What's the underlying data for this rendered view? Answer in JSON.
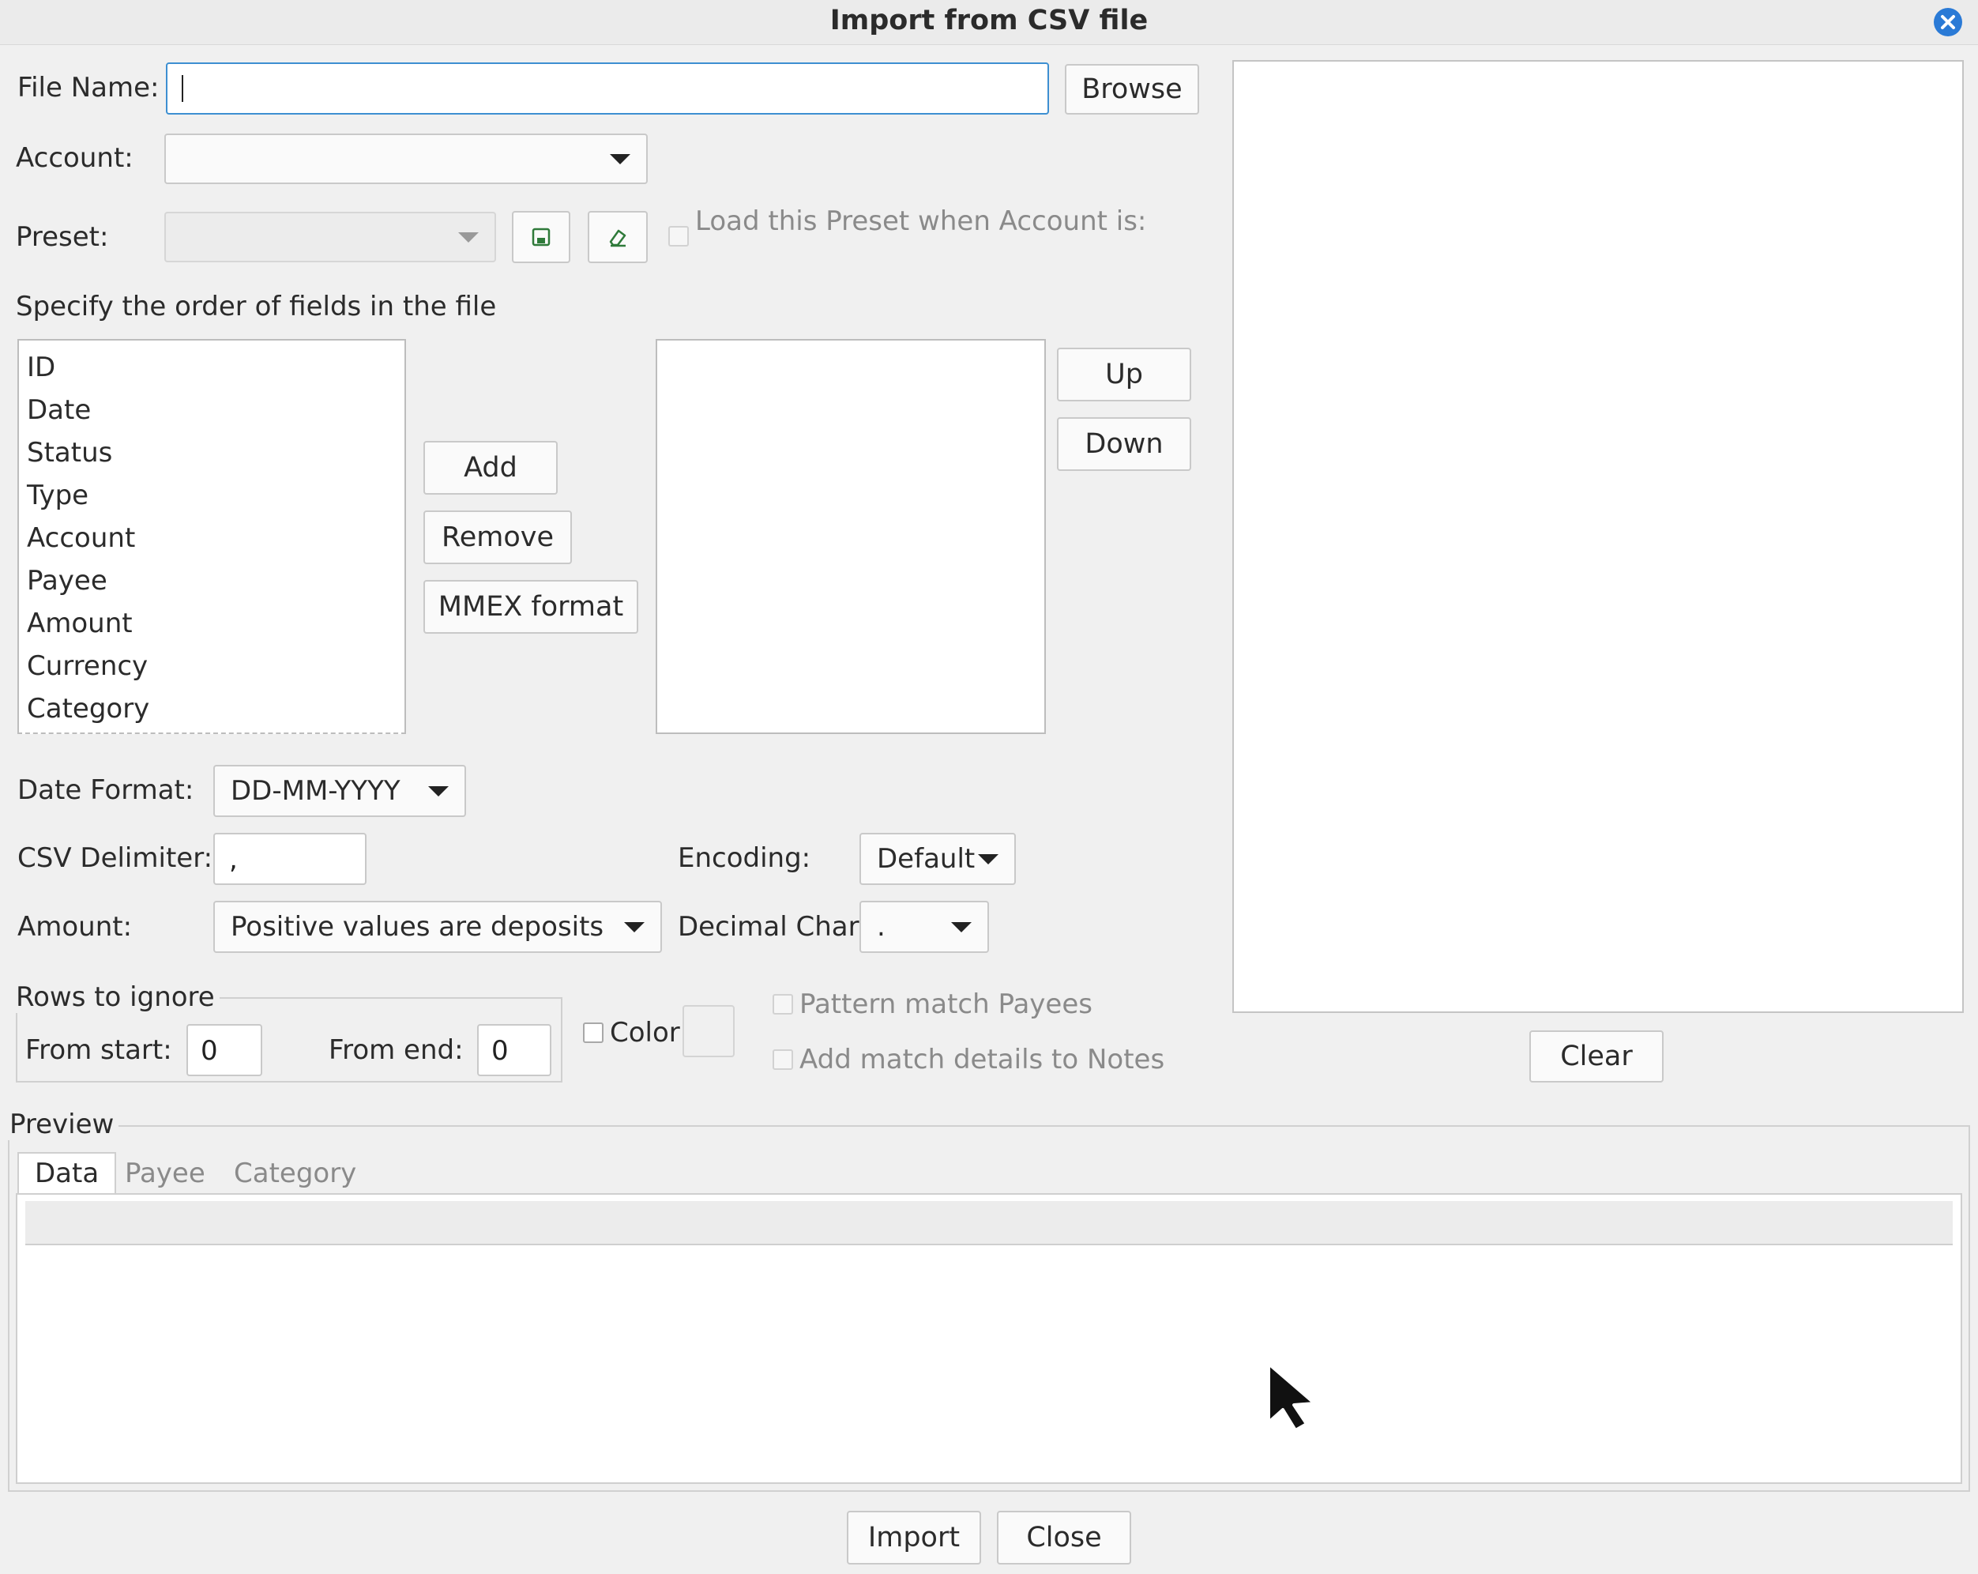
{
  "window": {
    "title": "Import from CSV file"
  },
  "file": {
    "label": "File Name:",
    "value": "",
    "browse": "Browse"
  },
  "account": {
    "label": "Account:",
    "value": ""
  },
  "preset": {
    "label": "Preset:",
    "value": "",
    "load_label": "Load this Preset when Account is:"
  },
  "fields": {
    "heading": "Specify the order of fields in the file",
    "available": [
      "ID",
      "Date",
      "Status",
      "Type",
      "Account",
      "Payee",
      "Amount",
      "Currency",
      "Category"
    ],
    "selected": [],
    "add": "Add",
    "remove": "Remove",
    "mmex": "MMEX format",
    "up": "Up",
    "down": "Down"
  },
  "date_format": {
    "label": "Date Format:",
    "value": "DD-MM-YYYY"
  },
  "csv_delimiter": {
    "label": "CSV Delimiter:",
    "value": ","
  },
  "encoding": {
    "label": "Encoding:",
    "value": "Default"
  },
  "amount": {
    "label": "Amount:",
    "value": "Positive values are deposits"
  },
  "decimal_char": {
    "label": "Decimal Char",
    "value": "."
  },
  "rows_ignore": {
    "legend": "Rows to ignore",
    "from_start_label": "From start:",
    "from_start": "0",
    "from_end_label": "From end:",
    "from_end": "0"
  },
  "color": {
    "label": "Color"
  },
  "pattern_match": "Pattern match Payees",
  "add_match_notes": "Add match details to Notes",
  "log": {
    "clear": "Clear"
  },
  "preview": {
    "legend": "Preview",
    "tabs": [
      "Data",
      "Payee",
      "Category"
    ]
  },
  "footer": {
    "import": "Import",
    "close": "Close"
  },
  "colors": {
    "accent": "#3d8fd1",
    "close_icon": "#2a7ad6"
  }
}
